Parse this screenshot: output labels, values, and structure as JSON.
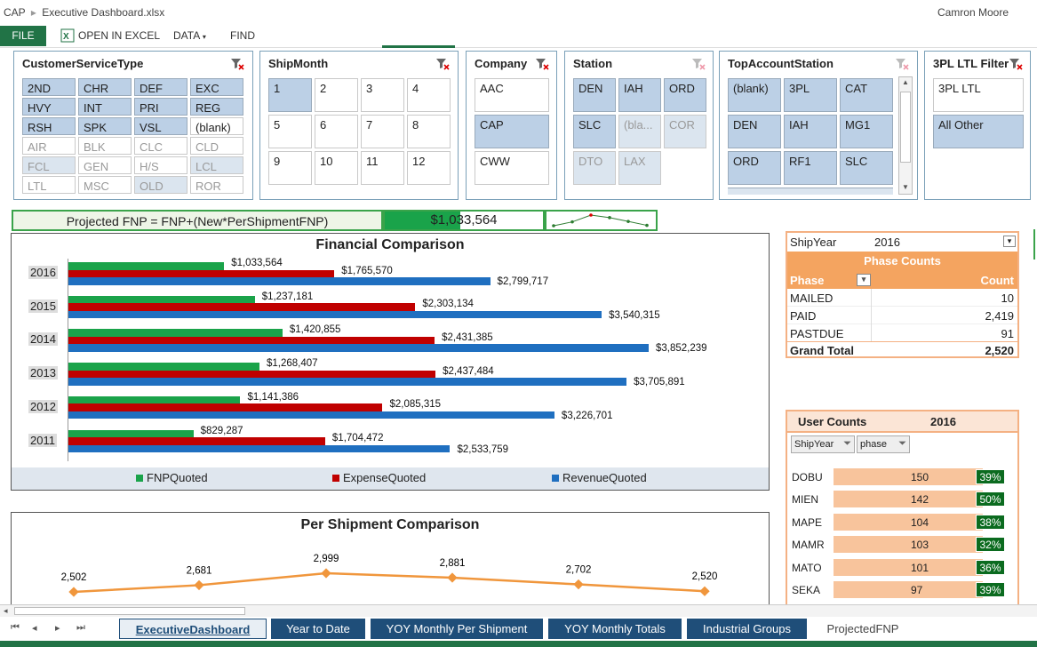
{
  "titlebar": {
    "app": "CAP",
    "file": "Executive Dashboard.xlsx",
    "user": "Camron Moore"
  },
  "ribbon": {
    "file": "FILE",
    "open_excel": "OPEN IN EXCEL",
    "data": "DATA",
    "find": "FIND"
  },
  "slicers": {
    "cst": {
      "title": "CustomerServiceType",
      "items": [
        "2ND",
        "CHR",
        "DEF",
        "EXC",
        "HVY",
        "INT",
        "PRI",
        "REG",
        "RSH",
        "SPK",
        "VSL",
        "(blank)",
        "AIR",
        "BLK",
        "CLC",
        "CLD",
        "FCL",
        "GEN",
        "H/S",
        "LCL",
        "LTL",
        "MSC",
        "OLD",
        "ROR"
      ]
    },
    "shipmonth": {
      "title": "ShipMonth",
      "items": [
        "1",
        "2",
        "3",
        "4",
        "5",
        "6",
        "7",
        "8",
        "9",
        "10",
        "11",
        "12"
      ]
    },
    "company": {
      "title": "Company",
      "items": [
        "AAC",
        "CAP",
        "CWW"
      ]
    },
    "station": {
      "title": "Station",
      "items": [
        "DEN",
        "IAH",
        "ORD",
        "SLC",
        "(bla...",
        "COR",
        "DTO",
        "LAX"
      ]
    },
    "tas": {
      "title": "TopAccountStation",
      "items": [
        "(blank)",
        "3PL",
        "CAT",
        "DEN",
        "IAH",
        "MG1",
        "ORD",
        "RF1",
        "SLC"
      ]
    },
    "ltl": {
      "title": "3PL LTL Filter",
      "items": [
        "3PL LTL",
        "All Other"
      ]
    }
  },
  "formula": {
    "text": "Projected FNP = FNP+(New*PerShipmentFNP)",
    "value": "$1,033,564",
    "fill_fraction": 0.48
  },
  "chart_data": [
    {
      "type": "bar",
      "title": "Financial Comparison",
      "orientation": "horizontal",
      "categories": [
        "2016",
        "2015",
        "2014",
        "2013",
        "2012",
        "2011"
      ],
      "series": [
        {
          "name": "FNPQuoted",
          "color": "#1aa34a",
          "values": [
            1033564,
            1237181,
            1420855,
            1268407,
            1141386,
            829287
          ],
          "labels": [
            "$1,033,564",
            "$1,237,181",
            "$1,420,855",
            "$1,268,407",
            "$1,141,386",
            "$829,287"
          ]
        },
        {
          "name": "ExpenseQuoted",
          "color": "#c00000",
          "values": [
            1765570,
            2303134,
            2431385,
            2437484,
            2085315,
            1704472
          ],
          "labels": [
            "$1,765,570",
            "$2,303,134",
            "$2,431,385",
            "$2,437,484",
            "$2,085,315",
            "$1,704,472"
          ]
        },
        {
          "name": "RevenueQuoted",
          "color": "#1f6fc0",
          "values": [
            2799717,
            3540315,
            3852239,
            3705891,
            3226701,
            2533759
          ],
          "labels": [
            "$2,799,717",
            "$3,540,315",
            "$3,852,239",
            "$3,705,891",
            "$3,226,701",
            "$2,533,759"
          ]
        }
      ],
      "xlim": [
        0,
        4000000
      ],
      "legend": "bottom"
    },
    {
      "type": "line",
      "title": "Per Shipment Comparison",
      "color": "#f0963c",
      "values": [
        2502,
        2681,
        2999,
        2881,
        2702,
        2520
      ],
      "labels": [
        "2,502",
        "2,681",
        "2,999",
        "2,881",
        "2,702",
        "2,520"
      ],
      "ylim": [
        1500,
        3300
      ]
    }
  ],
  "sparkline": {
    "values": [
      2502,
      2681,
      2999,
      2881,
      2702,
      2520
    ]
  },
  "phase": {
    "shipyear_label": "ShipYear",
    "shipyear": "2016",
    "title": "Phase Counts",
    "col_phase": "Phase",
    "col_count": "Count",
    "rows": [
      {
        "phase": "MAILED",
        "count": "10"
      },
      {
        "phase": "PAID",
        "count": "2,419"
      },
      {
        "phase": "PASTDUE",
        "count": "91"
      }
    ],
    "total_label": "Grand Total",
    "total": "2,520"
  },
  "usercounts": {
    "title": "User Counts",
    "year": "2016",
    "btn_shipyear": "ShipYear",
    "btn_phase": "phase",
    "rows": [
      {
        "name": "DOBU",
        "count": "150",
        "pct": "39%",
        "value": 150
      },
      {
        "name": "MIEN",
        "count": "142",
        "pct": "50%",
        "value": 142
      },
      {
        "name": "MAPE",
        "count": "104",
        "pct": "38%",
        "value": 104
      },
      {
        "name": "MAMR",
        "count": "103",
        "pct": "32%",
        "value": 103
      },
      {
        "name": "MATO",
        "count": "101",
        "pct": "36%",
        "value": 101
      },
      {
        "name": "SEKA",
        "count": "97",
        "pct": "39%",
        "value": 97
      }
    ]
  },
  "tabs": [
    "ExecutiveDashboard",
    "Year to Date",
    "YOY Monthly Per Shipment",
    "YOY Monthly Totals",
    "Industrial Groups",
    "ProjectedFNP"
  ],
  "colors": {
    "excel_green": "#217346",
    "tab_blue": "#1f4e79",
    "slicer_selected": "#bcd0e6",
    "orange": "#f4b183"
  }
}
